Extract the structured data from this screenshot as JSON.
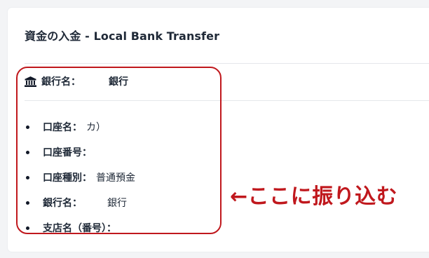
{
  "card": {
    "title": "資金の入金 - Local Bank Transfer"
  },
  "bank_header": {
    "icon": "bank-icon",
    "label": "銀行名：",
    "value": "銀行"
  },
  "details": {
    "items": [
      {
        "label": "口座名：",
        "value": "カ）"
      },
      {
        "label": "口座番号：",
        "value": ""
      },
      {
        "label": "口座種別：",
        "value": "普通預金"
      },
      {
        "label": "銀行名：",
        "value": "銀行"
      },
      {
        "label": "支店名（番号）：",
        "value": ""
      }
    ]
  },
  "annotation": {
    "text": "←ここに振り込む",
    "color": "#c0181d"
  }
}
